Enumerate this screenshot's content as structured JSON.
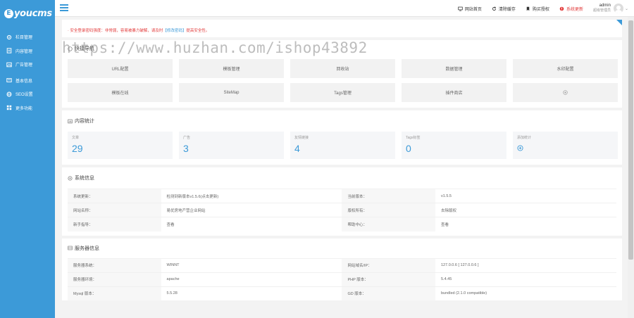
{
  "logo": {
    "mark": "E",
    "text": "youcms"
  },
  "sidebar": {
    "items": [
      {
        "label": "栏目管理",
        "icon": "gear-icon"
      },
      {
        "label": "内容管理",
        "icon": "document-icon"
      },
      {
        "label": "广告管理",
        "icon": "image-icon"
      },
      {
        "label": "基本信息",
        "icon": "card-icon"
      },
      {
        "label": "SEO设置",
        "icon": "globe-icon"
      },
      {
        "label": "更多功能",
        "icon": "grid-icon"
      }
    ]
  },
  "topbar": {
    "links": [
      {
        "label": "网站首页",
        "icon": "monitor-icon"
      },
      {
        "label": "清除缓存",
        "icon": "refresh-icon"
      },
      {
        "label": "购买授权",
        "icon": "bookmark-icon"
      },
      {
        "label": "系统更新",
        "icon": "alert-icon"
      }
    ],
    "user": {
      "name": "admin",
      "role": "超级管理员"
    }
  },
  "notice": {
    "text_before": "· 安全登录密码强度：非常弱，容易被暴力破解，请及时",
    "link": "【修改密码】",
    "text_after": "提高安全性。"
  },
  "watermark": "https://www.huzhan.com/ishop43892",
  "quick": {
    "title": "快捷导航",
    "items": [
      "URL配置",
      "模板管理",
      "回收站",
      "数据管理",
      "水印配置",
      "模板在线",
      "SiteMap",
      "Tags管理",
      "插件商店",
      ""
    ]
  },
  "stats": {
    "title": "内容统计",
    "items": [
      {
        "label": "文章",
        "value": "29"
      },
      {
        "label": "广告",
        "value": "3"
      },
      {
        "label": "友情链接",
        "value": "4"
      },
      {
        "label": "Tags标签",
        "value": "0"
      },
      {
        "label": "添加统计",
        "value": ""
      }
    ]
  },
  "system": {
    "title": "系统信息",
    "rows": [
      {
        "k1": "系统更新：",
        "v1": "检测到新版本v1.5.6(点击更新)",
        "k2": "当前版本：",
        "v2": "v1.5.5"
      },
      {
        "k1": "网站名称：",
        "v1": "易优房地产营企业网站",
        "k2": "版权所有：",
        "v2": "去除版权"
      },
      {
        "k1": "新手指导：",
        "v1": "查看",
        "k2": "帮助中心：",
        "v2": "查看"
      }
    ]
  },
  "server": {
    "title": "服务器信息",
    "rows": [
      {
        "k1": "服务器系统：",
        "v1": "WINNT",
        "k2": "网站域名/IP：",
        "v2": "127.0.0.6 [ 127.0.0.6 ]"
      },
      {
        "k1": "服务器环境：",
        "v1": "apache",
        "k2": "PHP 版本：",
        "v2": "5.4.45"
      },
      {
        "k1": "Mysql 版本：",
        "v1": "5.5.28",
        "k2": "GD 版本：",
        "v2": "bundled (2.1.0 compatible)"
      }
    ]
  },
  "colors": {
    "primary": "#3c9ad8",
    "danger": "#e23b3b"
  }
}
